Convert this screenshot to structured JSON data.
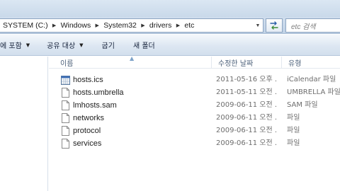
{
  "address_bar": {
    "crumbs": [
      "SYSTEM (C:)",
      "Windows",
      "System32",
      "drivers",
      "etc"
    ]
  },
  "search": {
    "placeholder": "etc 검색"
  },
  "command_bar": {
    "items": [
      {
        "label": "에 포함",
        "has_dropdown": true
      },
      {
        "label": "공유 대상",
        "has_dropdown": true
      },
      {
        "label": "굽기",
        "has_dropdown": false
      },
      {
        "label": "새 폴더",
        "has_dropdown": false
      }
    ]
  },
  "columns": {
    "name": "이름",
    "date": "수정한 날짜",
    "type": "유형"
  },
  "files": [
    {
      "name": "hosts.ics",
      "date": "2011-05-16 오후 ...",
      "type": "iCalendar 파일",
      "icon": "calendar-file-icon"
    },
    {
      "name": "hosts.umbrella",
      "date": "2011-05-11 오전 ...",
      "type": "UMBRELLA 파일",
      "icon": "file-icon"
    },
    {
      "name": "lmhosts.sam",
      "date": "2009-06-11 오전 ...",
      "type": "SAM 파일",
      "icon": "file-icon"
    },
    {
      "name": "networks",
      "date": "2009-06-11 오전 ...",
      "type": "파일",
      "icon": "file-icon"
    },
    {
      "name": "protocol",
      "date": "2009-06-11 오전 ...",
      "type": "파일",
      "icon": "file-icon"
    },
    {
      "name": "services",
      "date": "2009-06-11 오전 ...",
      "type": "파일",
      "icon": "file-icon"
    }
  ]
}
